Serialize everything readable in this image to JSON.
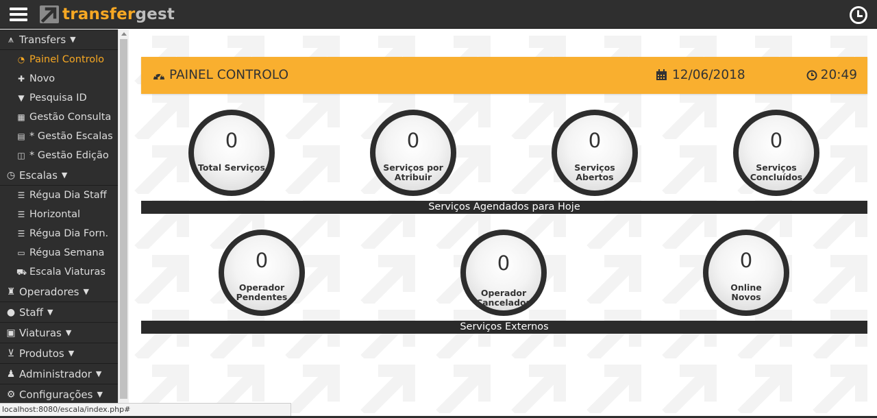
{
  "app": {
    "brand_a": "transfer",
    "brand_b": "gest",
    "accent_color": "#f7a823",
    "icons": {
      "menu": "hamburger-icon",
      "clock": "clock-icon",
      "logo": "arrow-logo-icon"
    }
  },
  "sidebar": {
    "groups": [
      {
        "label": "Transfers",
        "icon": "road-icon",
        "items": [
          {
            "label": "Painel Controlo",
            "icon": "dashboard-icon",
            "active": true
          },
          {
            "label": "Novo",
            "icon": "plus-icon"
          },
          {
            "label": "Pesquisa ID",
            "icon": "filter-icon"
          },
          {
            "label": "Gestão Consulta",
            "icon": "table-icon"
          },
          {
            "label": "* Gestão Escalas",
            "icon": "list-alt-icon"
          },
          {
            "label": "* Gestão Edição",
            "icon": "columns-icon"
          }
        ]
      },
      {
        "label": "Escalas",
        "icon": "clock-icon",
        "items": [
          {
            "label": "Régua Dia Staff",
            "icon": "list-icon"
          },
          {
            "label": "Horizontal",
            "icon": "list-icon"
          },
          {
            "label": "Régua Dia Forn.",
            "icon": "list-icon"
          },
          {
            "label": "Régua Semana",
            "icon": "calendar-icon"
          },
          {
            "label": "Escala Viaturas",
            "icon": "car-icon"
          }
        ]
      },
      {
        "label": "Operadores",
        "icon": "chess-rook-icon"
      },
      {
        "label": "Staff",
        "icon": "user-icon"
      },
      {
        "label": "Viaturas",
        "icon": "bus-icon"
      },
      {
        "label": "Produtos",
        "icon": "cart-icon"
      },
      {
        "label": "Administrador",
        "icon": "admin-icon"
      },
      {
        "label": "Configurações",
        "icon": "cog-icon"
      }
    ]
  },
  "header": {
    "title": "PAINEL CONTROLO",
    "date": "12/06/2018",
    "time": "20:49"
  },
  "stats_top": [
    {
      "value": "0",
      "label": "Total Serviços"
    },
    {
      "value": "0",
      "label_line1": "Serviços por",
      "label_line2": "Atribuir"
    },
    {
      "value": "0",
      "label_line1": "Serviços",
      "label_line2": "Abertos"
    },
    {
      "value": "0",
      "label_line1": "Serviços",
      "label_line2": "Concluídos"
    }
  ],
  "bar_top": "Serviços Agendados para Hoje",
  "stats_bottom": [
    {
      "value": "0",
      "label_line1": "Operador",
      "label_line2": "Pendentes"
    },
    {
      "value": "0",
      "label_line1": "Operador",
      "label_line2": "Cancelados"
    },
    {
      "value": "0",
      "label_line1": "Online",
      "label_line2": "Novos"
    }
  ],
  "bar_bottom": "Serviços Externos",
  "statusbar": "localhost:8080/escala/index.php#"
}
